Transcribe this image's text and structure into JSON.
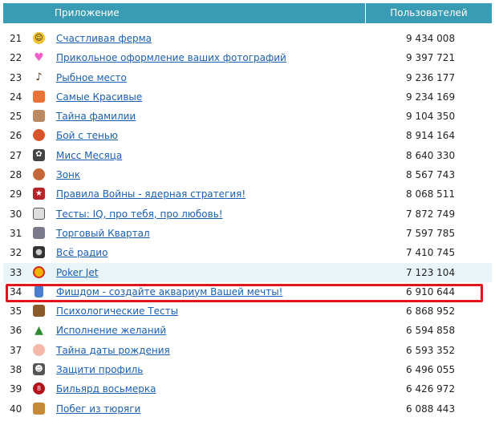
{
  "header": {
    "col_app": "Приложение",
    "col_users": "Пользователей"
  },
  "colors": {
    "header_bg": "#3a9cb4",
    "link": "#1b5fb0",
    "highlight_row": "#e8f4f7",
    "annotation_box": "#e3131b"
  },
  "rows": [
    {
      "num": "21",
      "icon": "sun-face-icon",
      "name": "Счастливая ферма",
      "users": "9 434 008"
    },
    {
      "num": "22",
      "icon": "heart-icon",
      "name": "Прикольное оформление ваших фотографий",
      "users": "9 397 721"
    },
    {
      "num": "23",
      "icon": "fishing-rod-icon",
      "name": "Рыбное место",
      "users": "9 236 177"
    },
    {
      "num": "24",
      "icon": "portrait-icon",
      "name": "Самые Красивые",
      "users": "9 234 169"
    },
    {
      "num": "25",
      "icon": "face-icon",
      "name": "Тайна фамилии",
      "users": "9 104 350"
    },
    {
      "num": "26",
      "icon": "fist-icon",
      "name": "Бой с тенью",
      "users": "8 914 164"
    },
    {
      "num": "27",
      "icon": "mask-icon",
      "name": "Мисс Месяца",
      "users": "8 640 330"
    },
    {
      "num": "28",
      "icon": "bell-icon",
      "name": "Зонк",
      "users": "8 567 743"
    },
    {
      "num": "29",
      "icon": "star-badge-icon",
      "name": "Правила Войны - ядерная стратегия!",
      "users": "8 068 511"
    },
    {
      "num": "30",
      "icon": "face-sketch-icon",
      "name": "Тесты: IQ, про тебя, про любовь!",
      "users": "7 872 749"
    },
    {
      "num": "31",
      "icon": "building-icon",
      "name": "Торговый Квартал",
      "users": "7 597 785"
    },
    {
      "num": "32",
      "icon": "radio-icon",
      "name": "Всё радио",
      "users": "7 410 745"
    },
    {
      "num": "33",
      "icon": "poker-chip-icon",
      "name": "Poker Jet",
      "users": "7 123 104",
      "highlight": true
    },
    {
      "num": "34",
      "icon": "aquarium-icon",
      "name": "Фишдом - создайте аквариум Вашей мечты!",
      "users": "6 910 644"
    },
    {
      "num": "35",
      "icon": "test-book-icon",
      "name": "Психологические Тесты",
      "users": "6 868 952"
    },
    {
      "num": "36",
      "icon": "tree-icon",
      "name": "Исполнение желаний",
      "users": "6 594 858"
    },
    {
      "num": "37",
      "icon": "baby-face-icon",
      "name": "Тайна даты рождения",
      "users": "6 593 352"
    },
    {
      "num": "38",
      "icon": "ghost-icon",
      "name": "Защити профиль",
      "users": "6 496 055"
    },
    {
      "num": "39",
      "icon": "billiard-ball-icon",
      "name": "Бильярд восьмерка",
      "users": "6 426 972"
    },
    {
      "num": "40",
      "icon": "prison-icon",
      "name": "Побег из тюряги",
      "users": "6 088 443"
    }
  ]
}
